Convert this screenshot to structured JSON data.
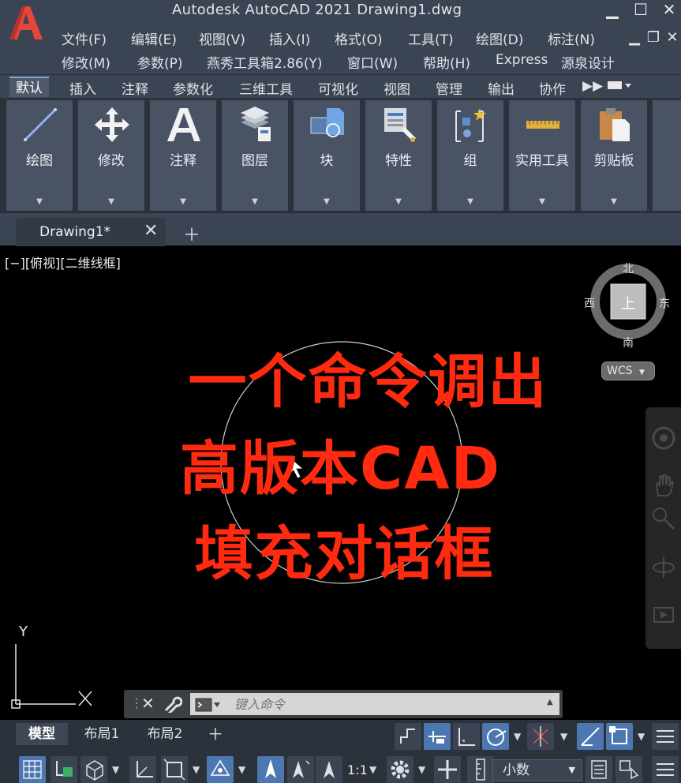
{
  "window": {
    "title": "Autodesk AutoCAD 2021    Drawing1.dwg",
    "logo_letter": "A"
  },
  "menus": {
    "row1": [
      "文件(F)",
      "编辑(E)",
      "视图(V)",
      "插入(I)",
      "格式(O)",
      "工具(T)",
      "绘图(D)",
      "标注(N)"
    ],
    "row2": [
      "修改(M)",
      "参数(P)",
      "燕秀工具箱2.86(Y)",
      "窗口(W)",
      "帮助(H)",
      "Express",
      "源泉设计"
    ]
  },
  "ribbon": {
    "tabs": [
      "默认",
      "插入",
      "注释",
      "参数化",
      "三维工具",
      "可视化",
      "视图",
      "管理",
      "输出",
      "协作"
    ],
    "active_tab": "默认",
    "panels": [
      "绘图",
      "修改",
      "注释",
      "图层",
      "块",
      "特性",
      "组",
      "实用工具",
      "剪贴板"
    ]
  },
  "document": {
    "tab_label": "Drawing1*"
  },
  "viewport": {
    "view_label": "[−][俯视][二维线框]",
    "overlay": [
      "一个命令调出",
      "高版本CAD",
      "填充对话框"
    ],
    "overlay_color": "#ff2a10",
    "compass": {
      "north": "北",
      "south": "南",
      "east": "东",
      "west": "西",
      "top": "上"
    },
    "wcs": "WCS",
    "axis_y": "Y"
  },
  "command_line": {
    "placeholder": "键入命令"
  },
  "status": {
    "layout_tabs": [
      "模型",
      "布局1",
      "布局2"
    ],
    "active_layout": "模型",
    "scale": "1:1",
    "units": "小数"
  },
  "colors": {
    "accent": "#4d77b0",
    "chrome": "#3b4453"
  }
}
